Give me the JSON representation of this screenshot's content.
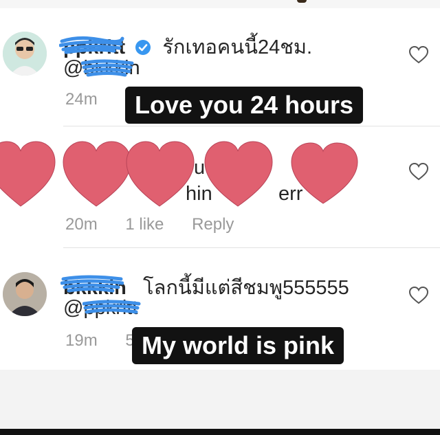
{
  "comments": [
    {
      "username": "ppkritt",
      "verified": true,
      "text": "รักเทอคนนี้24ชม.",
      "mention": "@bkkkin",
      "time": "24m",
      "like_icon": "heart-outline-icon"
    },
    {
      "username": "",
      "mention": "",
      "time": "20m",
      "likes": "1 like",
      "reply": "Reply",
      "like_icon": "heart-outline-icon"
    },
    {
      "username": "bkkkin",
      "text": "โลกนี้มีแต่สีชมพู555555",
      "mention": "@ppkritt",
      "time": "19m",
      "likes_partial": "5",
      "like_icon": "heart-outline-icon"
    }
  ],
  "captions": {
    "first": "Love you 24 hours",
    "second": "My world is pink"
  },
  "colors": {
    "scribble": "#3d8fe8",
    "hearts": "#e06070",
    "caption_bg": "#121212",
    "meta_text": "#999999",
    "verified": "#3897f0"
  },
  "overlay_icons": [
    "heart-sticker-icon",
    "heart-sticker-icon",
    "heart-sticker-icon",
    "heart-sticker-icon",
    "heart-sticker-icon"
  ]
}
